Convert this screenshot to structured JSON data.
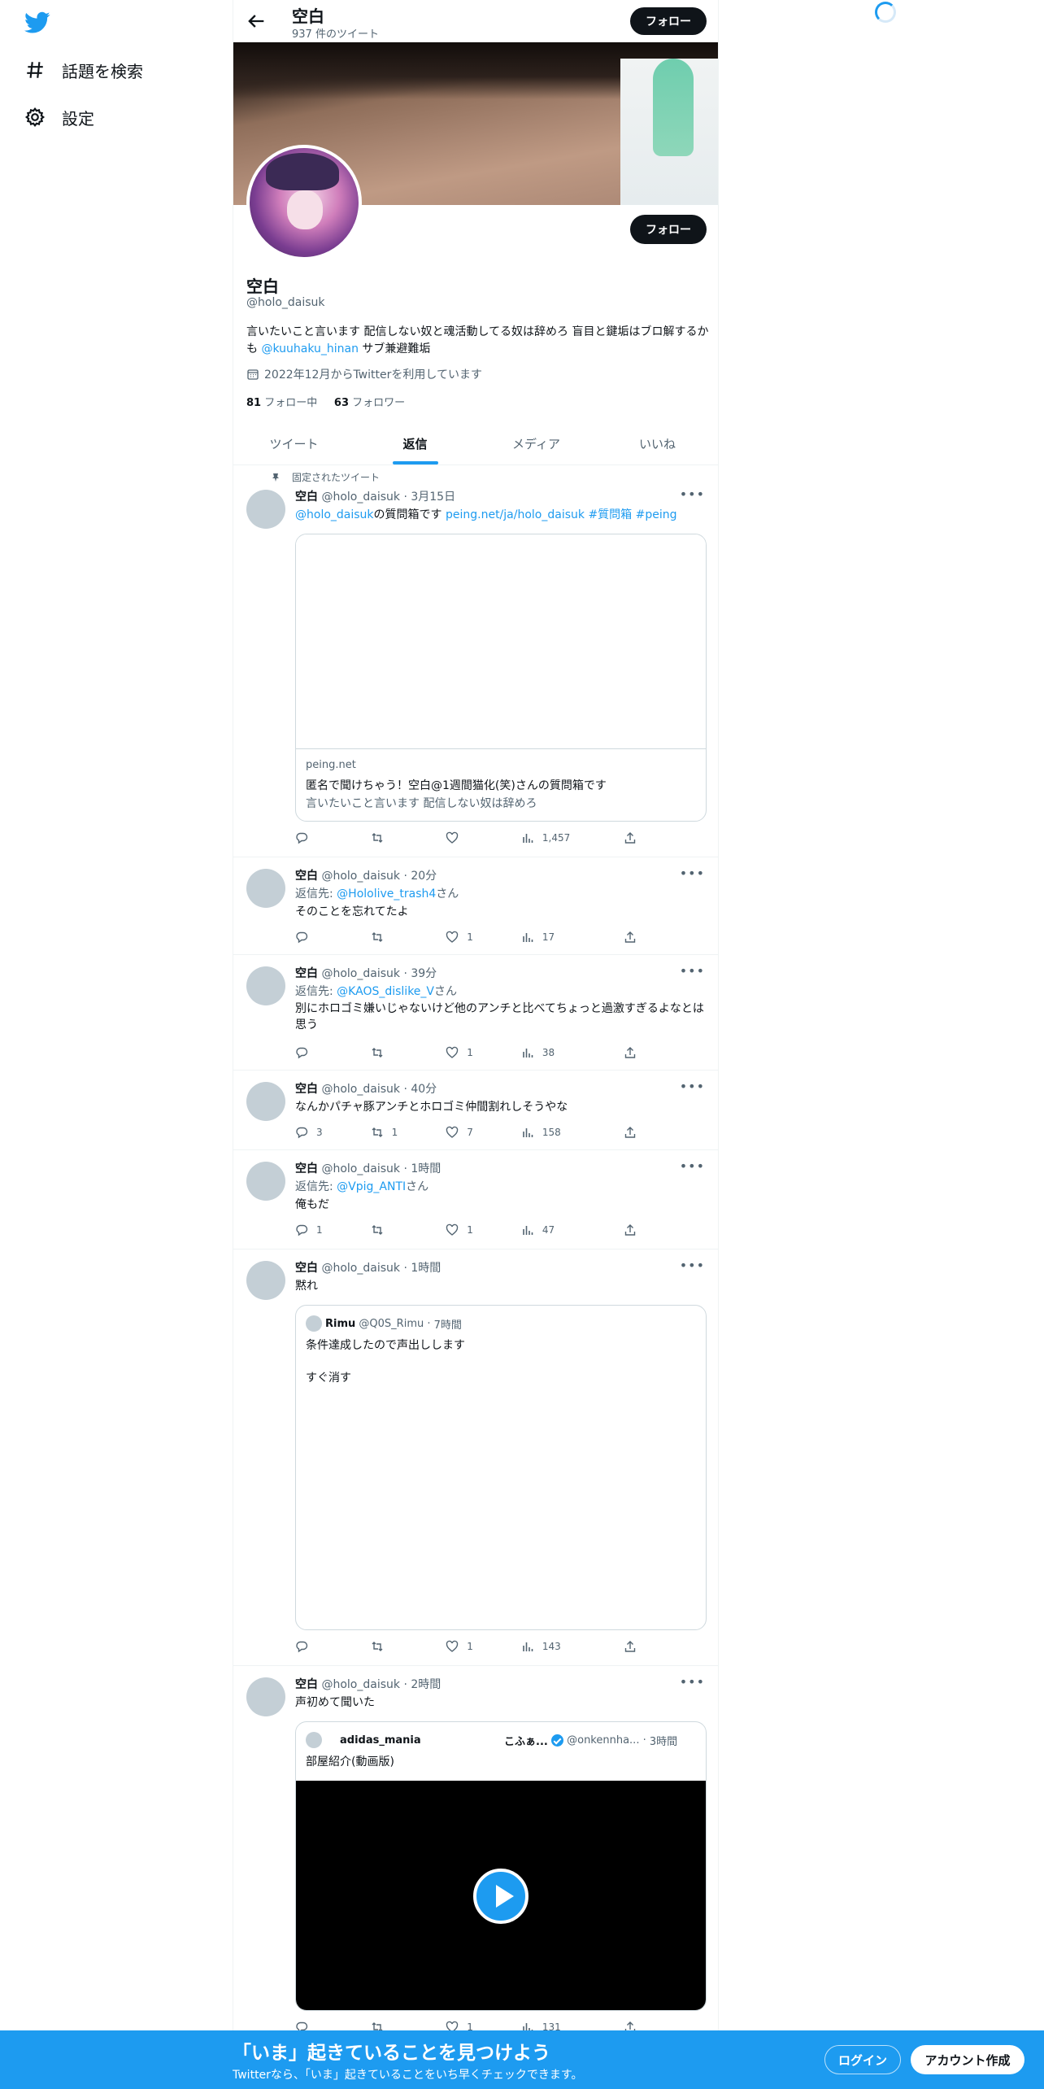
{
  "nav": {
    "items": [
      {
        "label": "話題を検索",
        "icon": "hashtag-icon"
      },
      {
        "label": "設定",
        "icon": "gear-icon"
      }
    ]
  },
  "header": {
    "title": "空白",
    "tweet_count": "937 件のツイート",
    "follow_label": "フォロー"
  },
  "profile": {
    "name": "空白",
    "handle": "@holo_daisuk",
    "bio_text_1": "言いたいこと言います 配信しない奴と魂活動してる奴は辞めろ 盲目と鍵垢はブロ解するかも ",
    "bio_mention": "@kuuhaku_hinan",
    "bio_text_2": " サブ兼避難垢",
    "joined": "2022年12月からTwitterを利用しています",
    "following_count": "81",
    "following_label": "フォロー中",
    "followers_count": "63",
    "followers_label": "フォロワー",
    "follow_label": "フォロー"
  },
  "tabs": [
    "ツイート",
    "返信",
    "メディア",
    "いいね"
  ],
  "pinned_label": "固定されたツイート",
  "tweets": [
    {
      "name": "空白",
      "handle": "@holo_daisuk",
      "time": "3月15日",
      "mention": "@holo_daisuk",
      "text_mid": "の質問箱です ",
      "url": "peing.net/ja/holo_daisuk",
      "tag1": "#質問箱",
      "tag2": "#peing",
      "card": {
        "domain": "peing.net",
        "title": "匿名で聞けちゃう！空白@1週間猫化(笑)さんの質問箱です",
        "desc": "言いたいこと言います 配信しない奴は辞めろ"
      },
      "views": "1,457"
    },
    {
      "name": "空白",
      "handle": "@holo_daisuk",
      "time": "20分",
      "reply_prefix": "返信先: ",
      "reply_to": "@Hololive_trash4",
      "reply_suffix": "さん",
      "text": "そのことを忘れてたよ",
      "likes": "1",
      "views": "17"
    },
    {
      "name": "空白",
      "handle": "@holo_daisuk",
      "time": "39分",
      "reply_prefix": "返信先: ",
      "reply_to": "@KAOS_dislike_V",
      "reply_suffix": "さん",
      "text": "別にホロゴミ嫌いじゃないけど他のアンチと比べてちょっと過激すぎるよなとは思う",
      "likes": "1",
      "views": "38"
    },
    {
      "name": "空白",
      "handle": "@holo_daisuk",
      "time": "40分",
      "text": "なんかパチャ豚アンチとホロゴミ仲間割れしそうやな",
      "replies": "3",
      "retweets": "1",
      "likes": "7",
      "views": "158"
    },
    {
      "name": "空白",
      "handle": "@holo_daisuk",
      "time": "1時間",
      "reply_prefix": "返信先: ",
      "reply_to": "@Vpig_ANTI",
      "reply_suffix": "さん",
      "text": "俺もだ",
      "replies": "1",
      "likes": "1",
      "views": "47"
    },
    {
      "name": "空白",
      "handle": "@holo_daisuk",
      "time": "1時間",
      "text": "黙れ",
      "quote": {
        "name": "Rimu",
        "handle": "@Q0S_Rimu",
        "time": "7時間",
        "line1": "条件達成したので声出しします",
        "line2": "すぐ消す"
      },
      "likes": "1",
      "views": "143"
    },
    {
      "name": "空白",
      "handle": "@holo_daisuk",
      "time": "2時間",
      "text": "声初めて聞いた",
      "quote": {
        "name": "adidas_mania",
        "name2": "こふぁ...",
        "handle": "@onkennha...",
        "time": "3時間",
        "line1": "部屋紹介(動画版)"
      },
      "likes": "1",
      "views": "131"
    }
  ],
  "bottom": {
    "title": "「いま」起きていることを見つけよう",
    "subtitle": "Twitterなら、「いま」起きていることをいち早くチェックできます。",
    "login": "ログイン",
    "signup": "アカウント作成"
  },
  "colors": {
    "accent": "#1d9bf0",
    "text": "#0f1419",
    "muted": "#536471"
  }
}
